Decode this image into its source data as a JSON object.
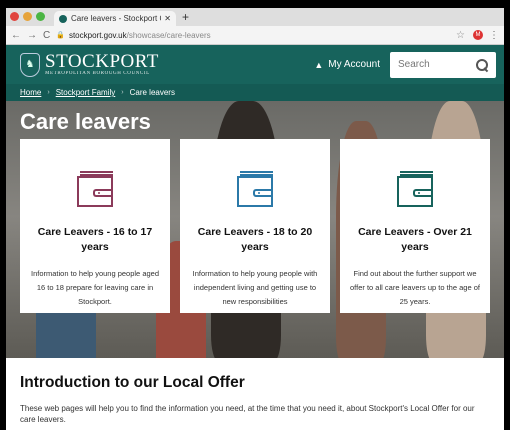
{
  "browser": {
    "tab_title": "Care leavers - Stockport Coun",
    "tab_close": "✕",
    "new_tab": "+",
    "url_domain": "stockport.gov.uk",
    "url_path": "/showcase/care-leavers",
    "extension_badge": "M",
    "colors": {
      "close": "#e0443e",
      "min": "#e6a33a",
      "max": "#4bb543",
      "favicon": "#17635c"
    }
  },
  "header": {
    "logo_name": "STOCKPORT",
    "logo_subtitle": "METROPOLITAN BOROUGH COUNCIL",
    "account_label": "My Account",
    "search_placeholder": "Search",
    "brand_color": "#17635c"
  },
  "breadcrumb": {
    "items": [
      "Home",
      "Stockport Family",
      "Care leavers"
    ]
  },
  "hero": {
    "title": "Care leavers"
  },
  "cards": [
    {
      "title": "Care Leavers - 16 to 17 years",
      "text": "Information to help young people aged 16 to 18 prepare for leaving care in Stockport.",
      "icon": "wallet-icon",
      "icon_color": "#8b3a5a"
    },
    {
      "title": "Care Leavers - 18 to 20 years",
      "text": "Information to help young people with independent living and getting use to new responsibilities",
      "icon": "wallet-icon",
      "icon_color": "#2b79a8"
    },
    {
      "title": "Care Leavers - Over 21 years",
      "text": "Find out about the further support we offer to all care leavers up to the age of 25 years.",
      "icon": "wallet-icon",
      "icon_color": "#17635c"
    }
  ],
  "intro": {
    "heading": "Introduction to our Local Offer",
    "text": "These web pages will help you to find the information you need, at the time that you need it, about Stockport's Local Offer for our care leavers."
  }
}
